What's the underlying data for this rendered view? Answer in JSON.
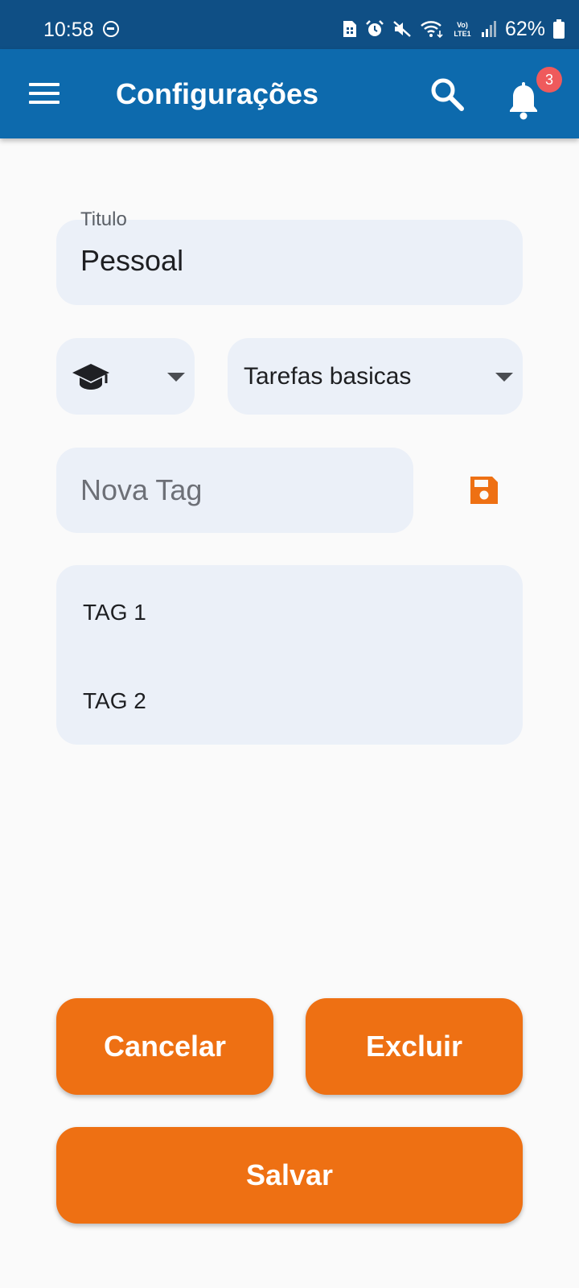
{
  "status_bar": {
    "time": "10:58",
    "battery": "62%",
    "icons": [
      "dnd-icon",
      "sim-card-icon",
      "alarm-icon",
      "mute-icon",
      "wifi-icon",
      "volte-icon",
      "signal-icon",
      "battery-icon"
    ]
  },
  "app_bar": {
    "title": "Configurações",
    "notification_count": "3",
    "icons": [
      "menu-icon",
      "search-icon",
      "bell-icon"
    ]
  },
  "form": {
    "title_label": "Titulo",
    "title_value": "Pessoal",
    "icon_select": {
      "selected_icon": "graduation-cap-icon"
    },
    "category_select": {
      "selected": "Tarefas basicas"
    },
    "new_tag": {
      "placeholder": "Nova Tag",
      "value": ""
    },
    "tags": [
      "TAG 1",
      "TAG 2"
    ]
  },
  "actions": {
    "cancel_label": "Cancelar",
    "delete_label": "Excluir",
    "save_label": "Salvar"
  },
  "colors": {
    "status_bar": "#0f4f85",
    "app_bar": "#0d6aad",
    "accent": "#ee7013",
    "field_bg": "#ebf0f8",
    "badge": "#ef5a5c",
    "page_bg": "#fafafa"
  }
}
